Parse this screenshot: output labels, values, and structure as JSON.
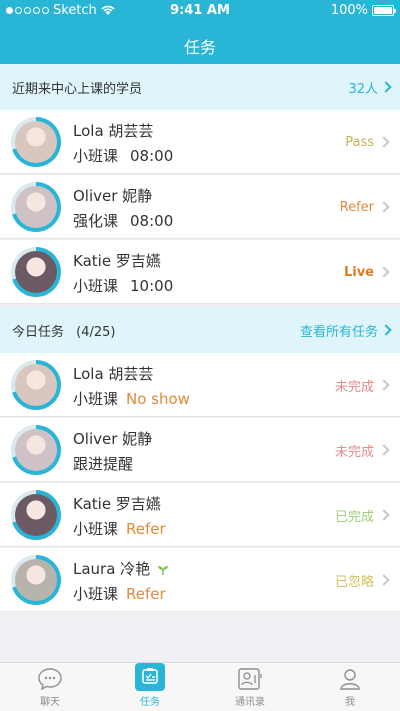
{
  "statusbar": {
    "carrier": "Sketch",
    "time": "9:41 AM",
    "battery": "100%"
  },
  "nav": {
    "title": "任务"
  },
  "recent": {
    "title": "近期来中心上课的学员",
    "count": "32人",
    "students": [
      {
        "name": "Lola  胡芸芸",
        "course": "小班课",
        "time": "08:00",
        "status": "Pass",
        "status_color": "#c9b25a",
        "avatar_color": "#d9c7bf"
      },
      {
        "name": "Oliver  妮静",
        "course": "强化课",
        "time": "08:00",
        "status": "Refer",
        "status_color": "#e08a3c",
        "avatar_color": "#cfc2c6"
      },
      {
        "name": "Katie  罗吉嬿",
        "course": "小班课",
        "time": "10:00",
        "status": "Live",
        "status_color": "#e07b20",
        "avatar_color": "#6b5a63"
      }
    ]
  },
  "tasks": {
    "title": "今日任务",
    "count": "(4/25)",
    "view_all": "查看所有任务",
    "items": [
      {
        "name": "Lola  胡芸芸",
        "task": "小班课",
        "note": "No show",
        "status": "未完成",
        "status_color": "#e88a8a",
        "avatar_color": "#d9c7bf"
      },
      {
        "name": "Oliver  妮静",
        "task": "跟进提醒",
        "note": "",
        "status": "未完成",
        "status_color": "#e88a8a",
        "avatar_color": "#cfc2c6"
      },
      {
        "name": "Katie  罗吉嬿",
        "task": "小班课",
        "note": "Refer",
        "status": "已完成",
        "status_color": "#9fcf7a",
        "avatar_color": "#6b5a63"
      },
      {
        "name": "Laura  冷艳",
        "task": "小班课",
        "note": "Refer",
        "status": "已忽略",
        "status_color": "#d4bf5a",
        "avatar_color": "#b9b3ad"
      }
    ]
  },
  "tabbar": [
    {
      "label": "聊天",
      "icon": "chat-icon"
    },
    {
      "label": "任务",
      "icon": "tasks-icon"
    },
    {
      "label": "通讯录",
      "icon": "contacts-icon"
    },
    {
      "label": "我",
      "icon": "profile-icon"
    }
  ],
  "colors": {
    "accent": "#29b6d6",
    "section_bg": "#e0f5fb"
  }
}
